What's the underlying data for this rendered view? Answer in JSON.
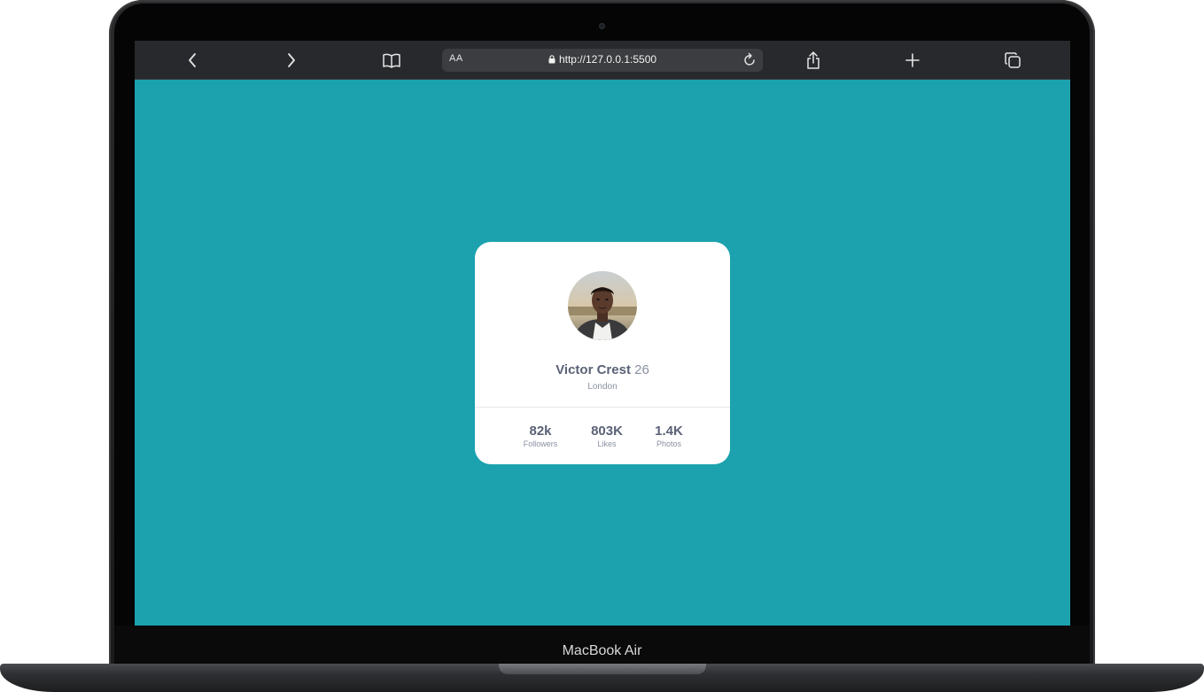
{
  "device": {
    "label": "MacBook Air"
  },
  "browser": {
    "text_size_button": "AA",
    "url": "http://127.0.0.1:5500",
    "icons": [
      "back-icon",
      "forward-icon",
      "bookmarks-icon",
      "lock-icon",
      "reload-icon",
      "share-icon",
      "new-tab-icon",
      "tabs-icon"
    ]
  },
  "page": {
    "background_color": "#1ba2ae"
  },
  "profile_card": {
    "name": "Victor Crest",
    "age": "26",
    "city": "London",
    "stats": [
      {
        "value": "82k",
        "label": "Followers"
      },
      {
        "value": "803K",
        "label": "Likes"
      },
      {
        "value": "1.4K",
        "label": "Photos"
      }
    ]
  }
}
